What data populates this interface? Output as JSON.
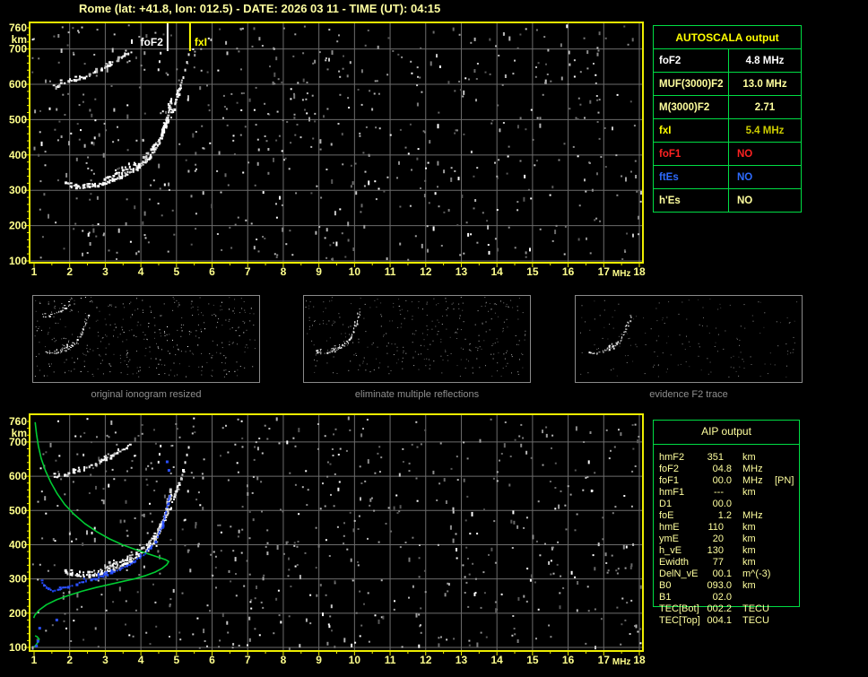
{
  "title": "Rome (lat: +41.8, lon: 012.5) - DATE: 2026 03 11 - TIME (UT): 04:15",
  "colors": {
    "background": "#000000",
    "frame_yellow": "#EDED00",
    "axis_label": "#FFFF8C",
    "grid_gray": "#6C6C6C",
    "trace_white": "#FFFFFF",
    "profile_green": "#00CC33",
    "restored_blue": "#2B50FF",
    "table_border_green": "#00DD44",
    "panel_border_gray": "#8A8A8A",
    "caption_gray": "#8F8F8F",
    "title_yellow": "#FFFFA0",
    "bright_yellow": "#FFFF00",
    "pale_yellow": "#FFFF9E",
    "gold": "#CDCD00",
    "red": "#FF2222",
    "blue": "#2E6BFF",
    "white": "#FFFFFF"
  },
  "axes": {
    "x_ticks": [
      1,
      2,
      3,
      4,
      5,
      6,
      7,
      8,
      9,
      10,
      11,
      12,
      13,
      14,
      15,
      16,
      17,
      18
    ],
    "x_unit": "MHz",
    "y_ticks": [
      760,
      700,
      600,
      500,
      400,
      300,
      200,
      100
    ],
    "y_unit": "km",
    "x_range": [
      1,
      18
    ],
    "y_range": [
      100,
      760
    ]
  },
  "top_plot": {
    "markers": [
      {
        "name": "foF2",
        "label": "foF2",
        "freq": 4.75,
        "color": "#FFFFFF",
        "side": "left"
      },
      {
        "name": "fxI",
        "label": "fxI",
        "freq": 5.38,
        "color": "#FFFF00",
        "side": "right"
      }
    ]
  },
  "traces": {
    "multiple_reflection": [
      [
        1.55,
        598
      ],
      [
        1.68,
        602
      ],
      [
        1.82,
        606
      ],
      [
        1.96,
        610
      ],
      [
        2.1,
        614
      ],
      [
        2.25,
        619
      ],
      [
        2.4,
        624
      ],
      [
        2.55,
        630
      ],
      [
        2.7,
        637
      ],
      [
        2.85,
        644
      ],
      [
        3.0,
        652
      ],
      [
        3.15,
        660
      ],
      [
        3.3,
        669
      ],
      [
        3.45,
        678
      ],
      [
        3.58,
        686
      ],
      [
        3.68,
        694
      ]
    ],
    "f2_ordinary": [
      [
        1.88,
        323
      ],
      [
        2.02,
        316
      ],
      [
        2.18,
        313
      ],
      [
        2.35,
        312
      ],
      [
        2.52,
        313
      ],
      [
        2.7,
        316
      ],
      [
        2.88,
        320
      ],
      [
        3.06,
        325
      ],
      [
        3.24,
        331
      ],
      [
        3.42,
        339
      ],
      [
        3.6,
        348
      ],
      [
        3.78,
        358
      ],
      [
        3.94,
        370
      ],
      [
        4.1,
        384
      ],
      [
        4.24,
        400
      ],
      [
        4.37,
        418
      ],
      [
        4.48,
        438
      ],
      [
        4.57,
        460
      ],
      [
        4.65,
        484
      ],
      [
        4.72,
        510
      ],
      [
        4.78,
        537
      ],
      [
        4.82,
        562
      ]
    ],
    "f2_extraordinary": [
      [
        2.95,
        336
      ],
      [
        3.12,
        342
      ],
      [
        3.3,
        349
      ],
      [
        3.48,
        357
      ],
      [
        3.66,
        367
      ],
      [
        3.84,
        378
      ],
      [
        4.0,
        391
      ],
      [
        4.16,
        405
      ],
      [
        4.31,
        421
      ],
      [
        4.45,
        439
      ],
      [
        4.57,
        459
      ],
      [
        4.68,
        481
      ],
      [
        4.78,
        504
      ],
      [
        4.87,
        528
      ],
      [
        4.95,
        552
      ],
      [
        5.03,
        577
      ],
      [
        5.1,
        600
      ],
      [
        5.16,
        620
      ]
    ],
    "extra_dots": [
      [
        5.22,
        644
      ],
      [
        5.27,
        666
      ],
      [
        5.32,
        688
      ],
      [
        4.5,
        668
      ],
      [
        4.53,
        692
      ],
      [
        4.47,
        645
      ],
      [
        5.3,
        560
      ],
      [
        2.6,
        438
      ],
      [
        2.68,
        452
      ]
    ],
    "profile_green": [
      [
        1.03,
        758
      ],
      [
        1.07,
        722
      ],
      [
        1.12,
        688
      ],
      [
        1.2,
        652
      ],
      [
        1.32,
        616
      ],
      [
        1.47,
        582
      ],
      [
        1.65,
        549
      ],
      [
        1.86,
        518
      ],
      [
        2.12,
        489
      ],
      [
        2.42,
        462
      ],
      [
        2.76,
        438
      ],
      [
        3.12,
        417
      ],
      [
        3.48,
        400
      ],
      [
        3.84,
        386
      ],
      [
        4.18,
        374
      ],
      [
        4.48,
        364
      ],
      [
        4.7,
        356
      ],
      [
        4.78,
        351
      ],
      [
        4.73,
        342
      ],
      [
        4.6,
        331
      ],
      [
        4.4,
        320
      ],
      [
        4.14,
        310
      ],
      [
        3.84,
        301
      ],
      [
        3.5,
        293
      ],
      [
        3.13,
        284
      ],
      [
        2.74,
        275
      ],
      [
        2.34,
        264
      ],
      [
        1.97,
        252
      ],
      [
        1.63,
        239
      ],
      [
        1.35,
        225
      ],
      [
        1.14,
        209
      ],
      [
        1.02,
        194
      ],
      [
        0.99,
        186
      ]
    ],
    "profile_e_bump": [
      [
        1.0,
        101
      ],
      [
        1.06,
        108
      ],
      [
        1.12,
        117
      ],
      [
        1.14,
        124
      ],
      [
        1.09,
        131
      ],
      [
        1.03,
        134
      ]
    ],
    "restored_blue": [
      [
        1.18,
        297
      ],
      [
        1.27,
        285
      ],
      [
        1.38,
        274
      ],
      [
        1.5,
        268
      ],
      [
        1.64,
        270
      ],
      [
        1.8,
        276
      ],
      [
        1.98,
        282
      ],
      [
        2.18,
        288
      ],
      [
        2.38,
        294
      ],
      [
        2.58,
        300
      ],
      [
        2.78,
        307
      ],
      [
        2.98,
        314
      ],
      [
        3.18,
        322
      ],
      [
        3.38,
        331
      ],
      [
        3.58,
        341
      ],
      [
        3.77,
        352
      ],
      [
        3.94,
        364
      ],
      [
        4.1,
        378
      ],
      [
        4.25,
        394
      ],
      [
        4.38,
        413
      ],
      [
        4.49,
        435
      ],
      [
        4.58,
        459
      ],
      [
        4.65,
        485
      ],
      [
        4.71,
        512
      ],
      [
        4.75,
        537
      ]
    ],
    "blue_dots": [
      [
        1.6,
        184
      ],
      [
        1.12,
        160
      ],
      [
        1.07,
        122
      ],
      [
        1.03,
        108
      ],
      [
        4.75,
        621
      ],
      [
        4.7,
        646
      ]
    ]
  },
  "panels": [
    {
      "caption": "original ionogram resized"
    },
    {
      "caption": "eliminate multiple reflections"
    },
    {
      "caption": "evidence F2 trace"
    }
  ],
  "autoscala": {
    "header": "AUTOSCALA output",
    "rows": [
      {
        "label": "foF2",
        "value": "4.8 MHz",
        "label_color": "#FFFFFF",
        "value_color": "#FFFFFF"
      },
      {
        "label": "MUF(3000)F2",
        "value": "13.0 MHz",
        "label_color": "#FFFF9E",
        "value_color": "#FFFF9E"
      },
      {
        "label": "M(3000)F2",
        "value": "2.71",
        "label_color": "#FFFF9E",
        "value_color": "#FFFF9E"
      },
      {
        "label": "fxI",
        "value": "5.4 MHz",
        "label_color": "#FFFF00",
        "value_color": "#CDCD00"
      },
      {
        "label": "foF1",
        "value": "NO",
        "label_color": "#FF2222",
        "value_color": "#FF2222"
      },
      {
        "label": "ftEs",
        "value": "NO",
        "label_color": "#2E6BFF",
        "value_color": "#2E6BFF"
      },
      {
        "label": "h'Es",
        "value": "NO",
        "label_color": "#FFFF9E",
        "value_color": "#FFFF9E"
      }
    ]
  },
  "aip": {
    "header": "AIP output",
    "rows": [
      {
        "label": "hmF2",
        "value": "351",
        "unit": "km",
        "note": ""
      },
      {
        "label": "foF2",
        "value": "04.8",
        "unit": "MHz",
        "note": ""
      },
      {
        "label": "foF1",
        "value": "00.0",
        "unit": "MHz",
        "note": "[PN]"
      },
      {
        "label": "hmF1",
        "value": "---",
        "unit": "km",
        "note": ""
      },
      {
        "label": "D1",
        "value": "00.0",
        "unit": "",
        "note": ""
      },
      {
        "label": "foE",
        "value": "1.2",
        "unit": "MHz",
        "note": ""
      },
      {
        "label": "hmE",
        "value": "110",
        "unit": "km",
        "note": ""
      },
      {
        "label": "ymE",
        "value": "20",
        "unit": "km",
        "note": ""
      },
      {
        "label": "h_vE",
        "value": "130",
        "unit": "km",
        "note": ""
      },
      {
        "label": "Ewidth",
        "value": "77",
        "unit": "km",
        "note": ""
      },
      {
        "label": "DelN_vE",
        "value": "00.1",
        "unit": "m^(-3)",
        "note": ""
      },
      {
        "label": "B0",
        "value": "093.0",
        "unit": "km",
        "note": ""
      },
      {
        "label": "B1",
        "value": "02.0",
        "unit": "",
        "note": ""
      },
      {
        "label": "TEC[Bot]",
        "value": "002.2",
        "unit": "TECU",
        "note": ""
      },
      {
        "label": "TEC[Top]",
        "value": "004.1",
        "unit": "TECU",
        "note": ""
      }
    ]
  },
  "noise": {
    "top_seed": 1337,
    "top_count": 660,
    "bottom_seed": 4242,
    "bottom_count": 660,
    "panel_seeds": [
      11,
      22,
      33
    ],
    "panel_counts": [
      400,
      330,
      165
    ]
  }
}
